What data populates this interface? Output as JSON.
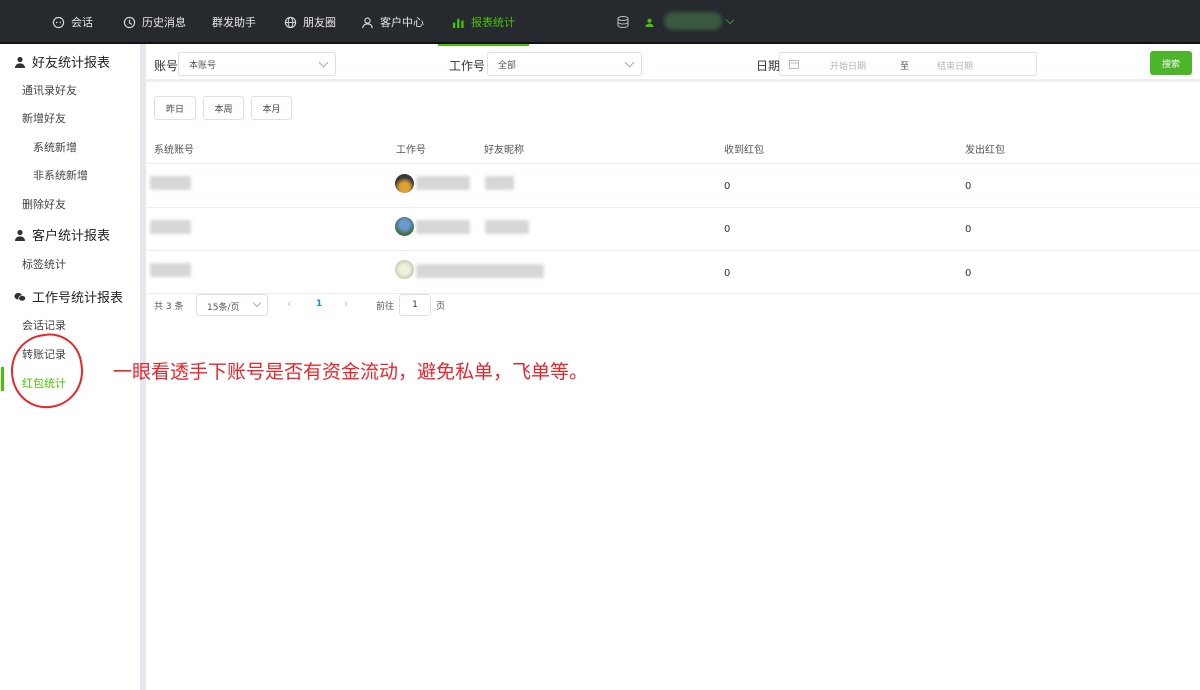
{
  "topnav": {
    "items": [
      {
        "label": "会话",
        "icon": "chat-icon"
      },
      {
        "label": "历史消息",
        "icon": "clock-icon"
      },
      {
        "label": "群发助手",
        "icon": ""
      },
      {
        "label": "朋友圈",
        "icon": "globe-icon"
      },
      {
        "label": "客户中心",
        "icon": "user-icon"
      },
      {
        "label": "报表统计",
        "icon": "bar-chart-icon",
        "active": true
      }
    ],
    "accent_color": "#47c400"
  },
  "sidebar": {
    "groups": [
      {
        "title": "好友统计报表",
        "icon": "person-icon"
      },
      {
        "title": "客户统计报表",
        "icon": "person-icon"
      },
      {
        "title": "工作号统计报表",
        "icon": "wechat-icon"
      }
    ],
    "items": [
      "通讯录好友",
      "新增好友",
      "系统新增",
      "非系统新增",
      "删除好友",
      "标签统计",
      "会话记录",
      "转账记录",
      "红包统计"
    ],
    "active_item": "红包统计"
  },
  "filters": {
    "account_label": "账号",
    "account_value": "本账号",
    "workid_label": "工作号",
    "workid_value": "全部",
    "date_label": "日期",
    "date_start_placeholder": "开始日期",
    "date_sep": "至",
    "date_end_placeholder": "结束日期",
    "search_label": "搜索"
  },
  "quick_ranges": [
    "昨日",
    "本周",
    "本月"
  ],
  "table": {
    "headers": [
      "系统账号",
      "工作号",
      "好友昵称",
      "收到红包",
      "发出红包"
    ],
    "rows": [
      {
        "received": "0",
        "sent": "0"
      },
      {
        "received": "0",
        "sent": "0"
      },
      {
        "received": "0",
        "sent": "0"
      }
    ]
  },
  "pagination": {
    "total": "共 3 条",
    "page_size": "15条/页",
    "current_page": "1",
    "goto_label": "前往",
    "goto_value": "1",
    "page_suffix": "页"
  },
  "annotation": "一眼看透手下账号是否有资金流动，避免私单，飞单等。",
  "colors": {
    "annotation": "#e8262b",
    "search_button": "#4db52a",
    "topbar": "#26292e"
  }
}
